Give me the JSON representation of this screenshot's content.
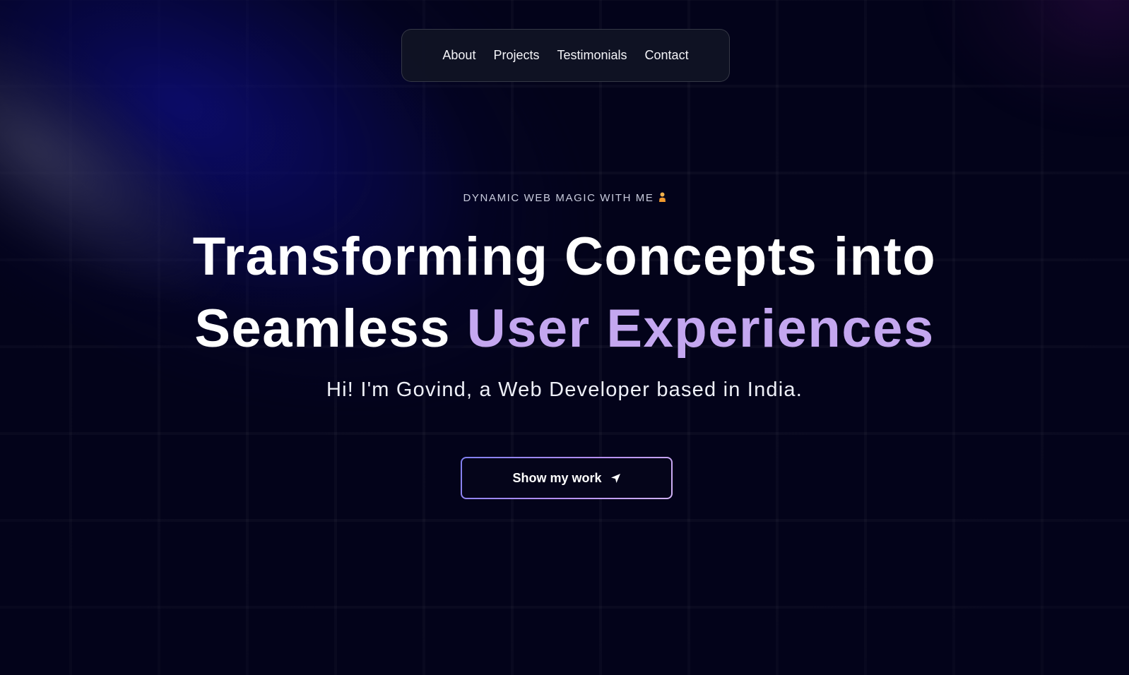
{
  "nav": {
    "items": [
      {
        "label": "About"
      },
      {
        "label": "Projects"
      },
      {
        "label": "Testimonials"
      },
      {
        "label": "Contact"
      }
    ]
  },
  "hero": {
    "eyebrow": "DYNAMIC WEB MAGIC WITH ME",
    "eyebrow_icon": "person-emoji-icon",
    "headline_line1": "Transforming Concepts into",
    "headline_line2_prefix": "Seamless",
    "headline_line2_accent": "User Experiences",
    "subtitle": "Hi! I'm Govind, a Web Developer based in India.",
    "cta_label": "Show my work",
    "cta_icon": "location-arrow-icon"
  },
  "colors": {
    "background": "#03031a",
    "accent": "#c4a7f0",
    "nav_background": "#101324"
  }
}
